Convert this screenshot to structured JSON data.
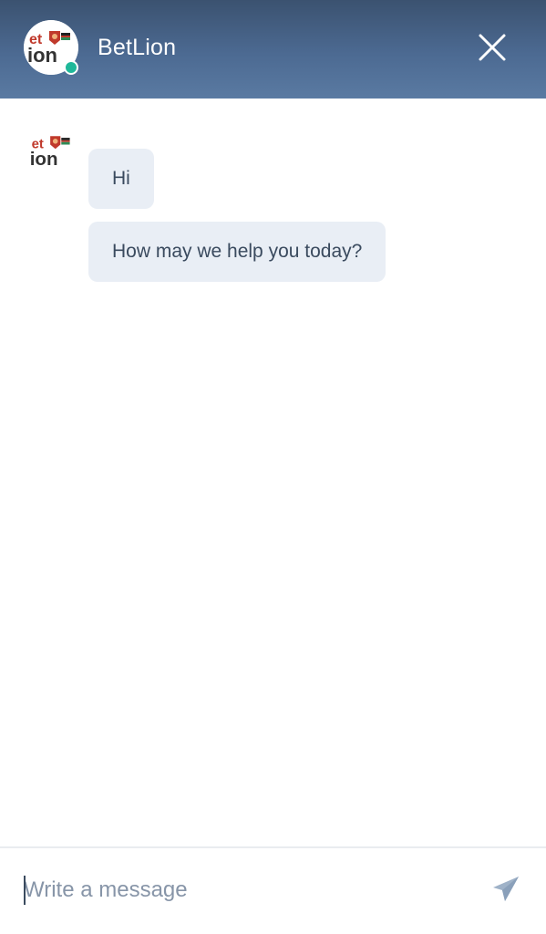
{
  "header": {
    "title": "BetLion",
    "avatar_icon": "betlion-logo-icon",
    "status": "online",
    "status_color": "#1fb89a",
    "close_icon": "close-icon"
  },
  "messages": [
    {
      "sender": "BetLion",
      "text": "Hi"
    },
    {
      "sender": "BetLion",
      "text": "How may we help you today?"
    }
  ],
  "composer": {
    "placeholder": "Write a message",
    "value": "",
    "send_icon": "send-icon"
  },
  "colors": {
    "header_gradient_top": "#3b5270",
    "header_gradient_bottom": "#5a7aa2",
    "bubble_bg": "#e9eef5",
    "bubble_text": "#3a4a5e",
    "logo_red": "#c0392b"
  }
}
